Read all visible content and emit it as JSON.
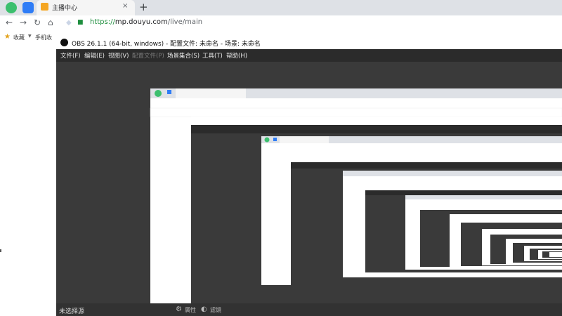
{
  "browser": {
    "tab_title": "主播中心",
    "tab_close": "×",
    "new_tab": "+",
    "url_https": "https://",
    "url_host": "mp.douyu.com",
    "url_path": "/live/main",
    "bookmarks": {
      "label": "收藏",
      "mobile": "手机收"
    },
    "colors": {
      "https_green": "#1e8e3e",
      "bookmark_star": "#e3a21a"
    }
  },
  "obs": {
    "title": "OBS 26.1.1 (64-bit, windows) - 配置文件: 未命名 - 场景: 未命名",
    "menu": [
      "文件(F)",
      "编辑(E)",
      "视图(V)",
      "配置文件(P)",
      "场景集合(S)",
      "工具(T)",
      "帮助(H)"
    ],
    "status_left": "未选择源",
    "properties_label": "属性",
    "filters_label": "滤镜",
    "preview_bg": "#3a3a3a"
  }
}
